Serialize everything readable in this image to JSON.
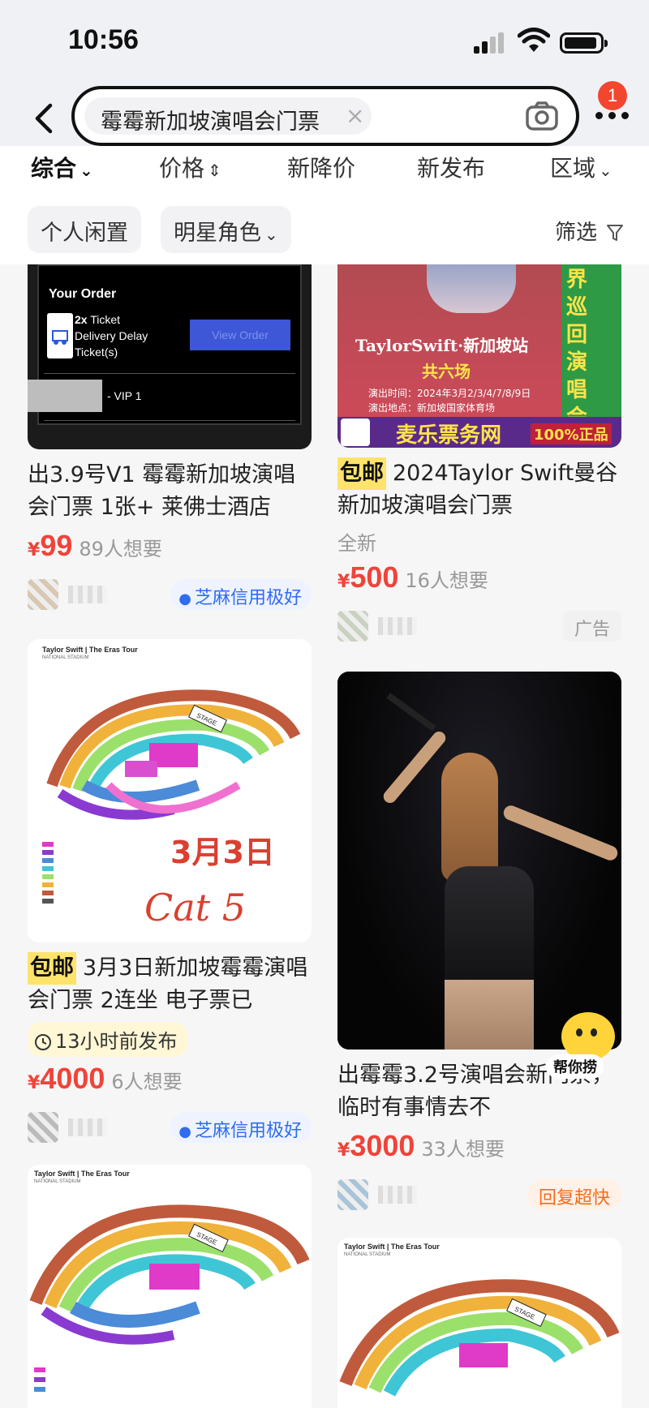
{
  "status": {
    "time": "10:56"
  },
  "header": {
    "search_text": "霉霉新加坡演唱会门票",
    "clear_glyph": "×",
    "notification_count": "1"
  },
  "sort": {
    "items": [
      {
        "label": "综合"
      },
      {
        "label": "价格"
      },
      {
        "label": "新降价"
      },
      {
        "label": "新发布"
      },
      {
        "label": "区域"
      }
    ]
  },
  "filters": {
    "chips": [
      {
        "label": "个人闲置"
      },
      {
        "label": "明星角色"
      }
    ],
    "filter_label": "筛选"
  },
  "listings": [
    {
      "image": {
        "order_header": "Your Order",
        "ticket_qty": "2x",
        "ticket_text_1": "Ticket",
        "ticket_text_2": "Delivery Delay",
        "ticket_text_3": "Ticket(s)",
        "view_order": "View Order",
        "vip_label": "- VIP 1"
      },
      "title": "出3.9号V1 霉霉新加坡演唱会门票 1张+ 莱佛士酒店",
      "currency": "¥",
      "price": "99",
      "wants": "89人想要",
      "seller_tag": "芝麻信用极好"
    },
    {
      "image": {
        "banner_title": "TaylorSwift·新加坡站",
        "banner_sub": "共六场",
        "time_line": "演出时间：2024年3月2/3/4/7/8/9日",
        "place_line": "演出地点：新加坡国家体育场",
        "side_text": "界巡回演唱会",
        "brand": "麦乐票务网",
        "authentic": "100%正品"
      },
      "badge": "包邮",
      "title": "2024Taylor Swift曼谷新加坡演唱会门票",
      "condition": "全新",
      "currency": "¥",
      "price": "500",
      "wants": "16人想要",
      "seller_tag": "广告"
    },
    {
      "image": {
        "map_title": "Taylor Swift | The Eras Tour",
        "map_sub": "NATIONAL STADIUM",
        "stage": "STAGE",
        "handwritten_date": "3月3日",
        "handwritten_cat": "Cat 5"
      },
      "badge": "包邮",
      "title": "3月3日新加坡霉霉演唱会门票 2连坐 电子票已",
      "posted": "13小时前发布",
      "currency": "¥",
      "price": "4000",
      "wants": "6人想要",
      "seller_tag": "芝麻信用极好"
    },
    {
      "image": {
        "helper_label": "帮你捞"
      },
      "title": "出霉霉3.2号演唱会新门票，临时有事情去不",
      "currency": "¥",
      "price": "3000",
      "wants": "33人想要",
      "seller_tag": "回复超快"
    },
    {
      "image": {
        "map_title": "Taylor Swift | The Eras Tour",
        "map_sub": "NATIONAL STADIUM",
        "stage": "STAGE"
      }
    },
    {
      "image": {
        "map_title": "Taylor Swift | The Eras Tour",
        "map_sub": "NATIONAL STADIUM",
        "stage": "STAGE"
      }
    }
  ],
  "colors": {
    "price_red": "#f0433a",
    "credit_blue": "#2f6cf0",
    "badge_yellow": "#ffe36b"
  }
}
